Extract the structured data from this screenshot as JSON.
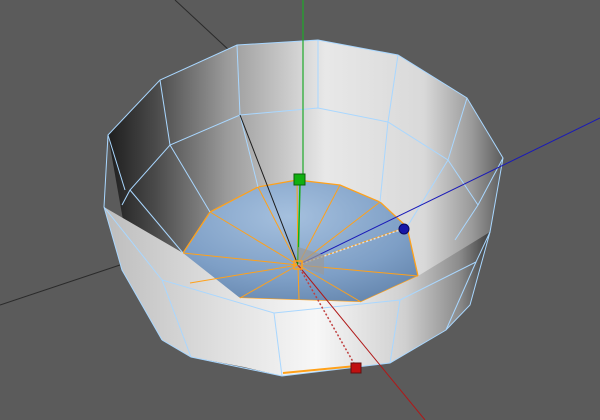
{
  "viewport": {
    "background_color": "#5b5b5b",
    "mode": "polygon-selection"
  },
  "axes": {
    "x_color": "#b01818",
    "y_color": "#1faa2a",
    "z_color": "#1a1ab8",
    "grid_color": "#2a2a2a"
  },
  "object": {
    "wireframe_color": "#a9d7ff",
    "selection_color": "#ffa11a",
    "selected_face_color": "#6f97c4"
  },
  "gizmo": {
    "x_handle_color": "#c01010",
    "y_handle_color": "#10b010",
    "z_handle_color": "#1616a8"
  }
}
